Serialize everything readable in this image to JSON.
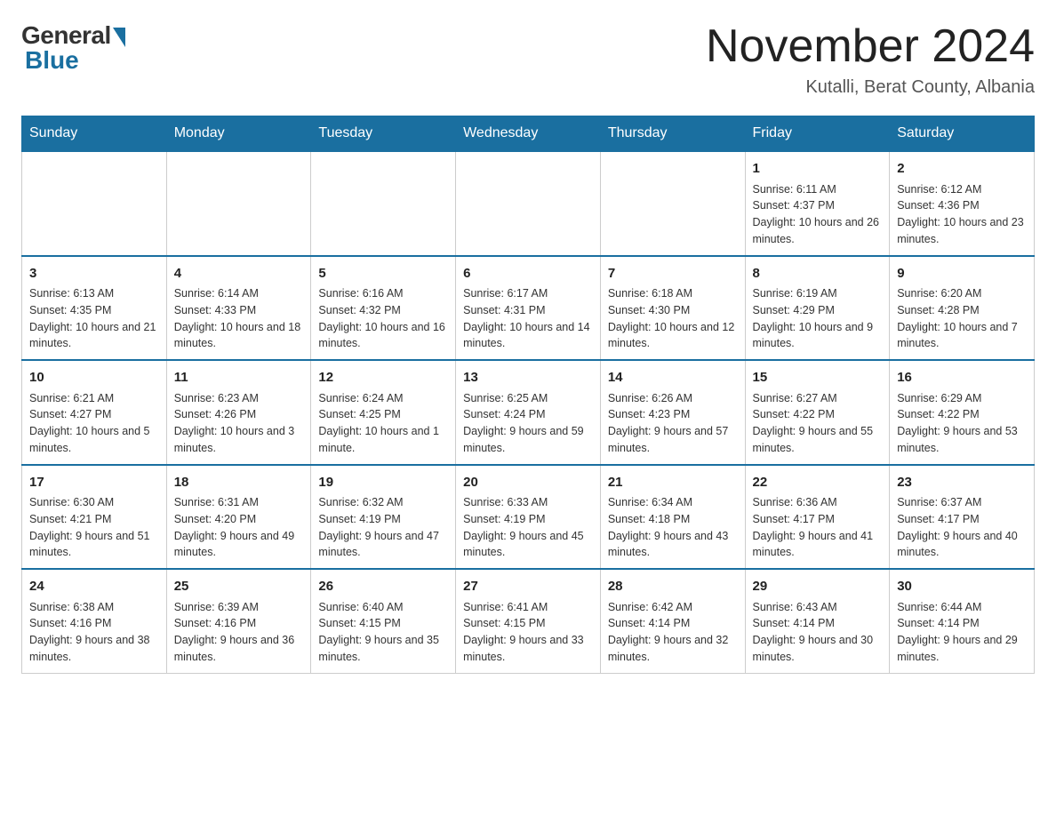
{
  "header": {
    "logo_general": "General",
    "logo_blue": "Blue",
    "month_title": "November 2024",
    "location": "Kutalli, Berat County, Albania"
  },
  "weekdays": [
    "Sunday",
    "Monday",
    "Tuesday",
    "Wednesday",
    "Thursday",
    "Friday",
    "Saturday"
  ],
  "weeks": [
    [
      {
        "day": "",
        "info": ""
      },
      {
        "day": "",
        "info": ""
      },
      {
        "day": "",
        "info": ""
      },
      {
        "day": "",
        "info": ""
      },
      {
        "day": "",
        "info": ""
      },
      {
        "day": "1",
        "info": "Sunrise: 6:11 AM\nSunset: 4:37 PM\nDaylight: 10 hours and 26 minutes."
      },
      {
        "day": "2",
        "info": "Sunrise: 6:12 AM\nSunset: 4:36 PM\nDaylight: 10 hours and 23 minutes."
      }
    ],
    [
      {
        "day": "3",
        "info": "Sunrise: 6:13 AM\nSunset: 4:35 PM\nDaylight: 10 hours and 21 minutes."
      },
      {
        "day": "4",
        "info": "Sunrise: 6:14 AM\nSunset: 4:33 PM\nDaylight: 10 hours and 18 minutes."
      },
      {
        "day": "5",
        "info": "Sunrise: 6:16 AM\nSunset: 4:32 PM\nDaylight: 10 hours and 16 minutes."
      },
      {
        "day": "6",
        "info": "Sunrise: 6:17 AM\nSunset: 4:31 PM\nDaylight: 10 hours and 14 minutes."
      },
      {
        "day": "7",
        "info": "Sunrise: 6:18 AM\nSunset: 4:30 PM\nDaylight: 10 hours and 12 minutes."
      },
      {
        "day": "8",
        "info": "Sunrise: 6:19 AM\nSunset: 4:29 PM\nDaylight: 10 hours and 9 minutes."
      },
      {
        "day": "9",
        "info": "Sunrise: 6:20 AM\nSunset: 4:28 PM\nDaylight: 10 hours and 7 minutes."
      }
    ],
    [
      {
        "day": "10",
        "info": "Sunrise: 6:21 AM\nSunset: 4:27 PM\nDaylight: 10 hours and 5 minutes."
      },
      {
        "day": "11",
        "info": "Sunrise: 6:23 AM\nSunset: 4:26 PM\nDaylight: 10 hours and 3 minutes."
      },
      {
        "day": "12",
        "info": "Sunrise: 6:24 AM\nSunset: 4:25 PM\nDaylight: 10 hours and 1 minute."
      },
      {
        "day": "13",
        "info": "Sunrise: 6:25 AM\nSunset: 4:24 PM\nDaylight: 9 hours and 59 minutes."
      },
      {
        "day": "14",
        "info": "Sunrise: 6:26 AM\nSunset: 4:23 PM\nDaylight: 9 hours and 57 minutes."
      },
      {
        "day": "15",
        "info": "Sunrise: 6:27 AM\nSunset: 4:22 PM\nDaylight: 9 hours and 55 minutes."
      },
      {
        "day": "16",
        "info": "Sunrise: 6:29 AM\nSunset: 4:22 PM\nDaylight: 9 hours and 53 minutes."
      }
    ],
    [
      {
        "day": "17",
        "info": "Sunrise: 6:30 AM\nSunset: 4:21 PM\nDaylight: 9 hours and 51 minutes."
      },
      {
        "day": "18",
        "info": "Sunrise: 6:31 AM\nSunset: 4:20 PM\nDaylight: 9 hours and 49 minutes."
      },
      {
        "day": "19",
        "info": "Sunrise: 6:32 AM\nSunset: 4:19 PM\nDaylight: 9 hours and 47 minutes."
      },
      {
        "day": "20",
        "info": "Sunrise: 6:33 AM\nSunset: 4:19 PM\nDaylight: 9 hours and 45 minutes."
      },
      {
        "day": "21",
        "info": "Sunrise: 6:34 AM\nSunset: 4:18 PM\nDaylight: 9 hours and 43 minutes."
      },
      {
        "day": "22",
        "info": "Sunrise: 6:36 AM\nSunset: 4:17 PM\nDaylight: 9 hours and 41 minutes."
      },
      {
        "day": "23",
        "info": "Sunrise: 6:37 AM\nSunset: 4:17 PM\nDaylight: 9 hours and 40 minutes."
      }
    ],
    [
      {
        "day": "24",
        "info": "Sunrise: 6:38 AM\nSunset: 4:16 PM\nDaylight: 9 hours and 38 minutes."
      },
      {
        "day": "25",
        "info": "Sunrise: 6:39 AM\nSunset: 4:16 PM\nDaylight: 9 hours and 36 minutes."
      },
      {
        "day": "26",
        "info": "Sunrise: 6:40 AM\nSunset: 4:15 PM\nDaylight: 9 hours and 35 minutes."
      },
      {
        "day": "27",
        "info": "Sunrise: 6:41 AM\nSunset: 4:15 PM\nDaylight: 9 hours and 33 minutes."
      },
      {
        "day": "28",
        "info": "Sunrise: 6:42 AM\nSunset: 4:14 PM\nDaylight: 9 hours and 32 minutes."
      },
      {
        "day": "29",
        "info": "Sunrise: 6:43 AM\nSunset: 4:14 PM\nDaylight: 9 hours and 30 minutes."
      },
      {
        "day": "30",
        "info": "Sunrise: 6:44 AM\nSunset: 4:14 PM\nDaylight: 9 hours and 29 minutes."
      }
    ]
  ]
}
